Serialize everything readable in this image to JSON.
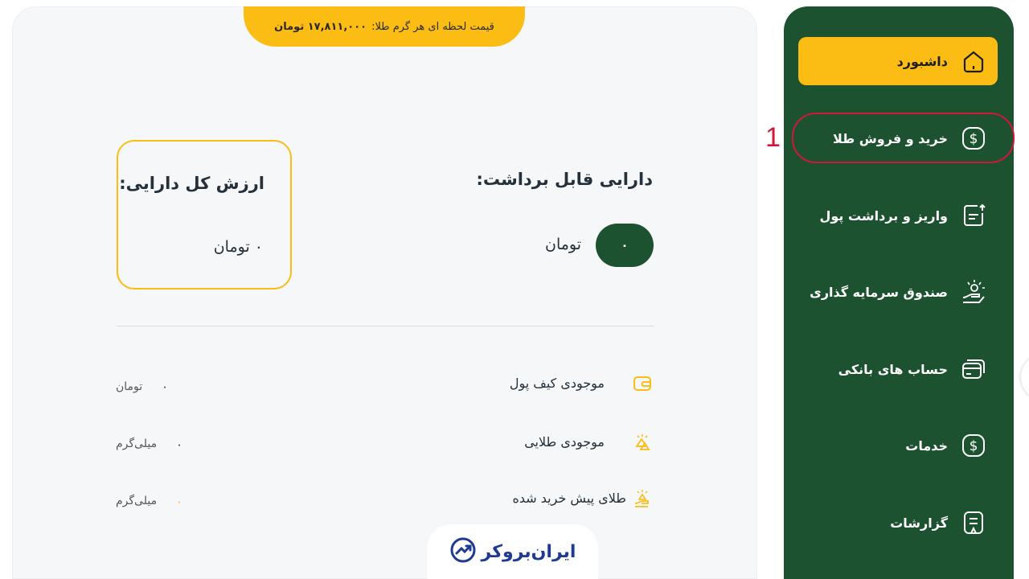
{
  "header": {
    "price_label": "قیمت لحظه ای هر گرم طلا:",
    "price_value": "۱۷,۸۱۱,۰۰۰ تومان"
  },
  "summary": {
    "total_title": "ارزش کل دارایی:",
    "total_value": "۰ تومان",
    "withdrawable_title": "دارایی قابل برداشت:",
    "withdrawable_value": "۰",
    "withdrawable_unit": "تومان"
  },
  "balances": [
    {
      "label": "موجودی کیف پول",
      "value": "۰",
      "unit": "تومان",
      "icon": "wallet-icon"
    },
    {
      "label": "موجودی طلایی",
      "value": "۰",
      "unit": "میلی‌گرم",
      "icon": "gold-bars-icon"
    },
    {
      "label": "طلای پیش خرید شده",
      "value": "۰",
      "unit": "میلی‌گرم",
      "icon": "gold-hand-icon"
    }
  ],
  "brand": {
    "logo_text": "ایران‌بروکر"
  },
  "sidebar": {
    "items": [
      {
        "label": "داشبورد",
        "icon": "home-icon",
        "active": true
      },
      {
        "label": "خرید و فروش طلا",
        "icon": "dollar-icon",
        "active": false
      },
      {
        "label": "واریز و برداشت پول",
        "icon": "receipt-icon",
        "active": false
      },
      {
        "label": "صندوق سرمایه گذاری",
        "icon": "hand-coins-icon",
        "active": false
      },
      {
        "label": "حساب های بانکی",
        "icon": "cards-icon",
        "active": false
      },
      {
        "label": "خدمات",
        "icon": "dollar-icon",
        "active": false
      },
      {
        "label": "گزارشات",
        "icon": "report-icon",
        "active": false
      }
    ]
  },
  "annotation": {
    "number": "1"
  },
  "colors": {
    "accent": "#fbbd13",
    "sidebar": "#1c5230",
    "annotation": "#d0183a"
  }
}
